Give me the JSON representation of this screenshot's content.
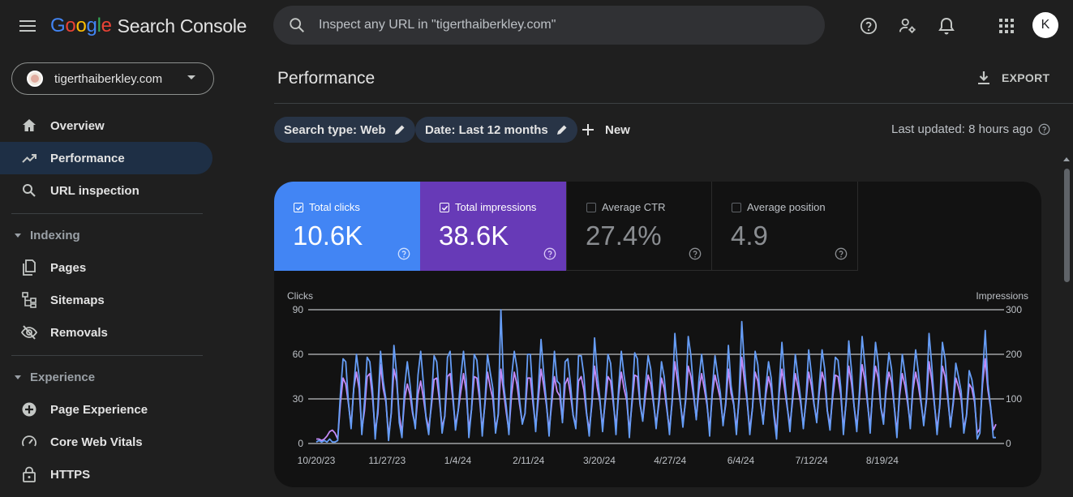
{
  "app": {
    "logo_letters": [
      "G",
      "o",
      "o",
      "g",
      "l",
      "e"
    ],
    "product": "Search Console"
  },
  "search": {
    "placeholder": "Inspect any URL in \"tigerthaiberkley.com\""
  },
  "user": {
    "avatar_initial": "K"
  },
  "icons": {
    "menu": "hamburger-menu-icon",
    "search": "search-icon",
    "help": "help-icon",
    "admin": "manage-users-icon",
    "notifications": "bell-icon",
    "apps": "apps-grid-icon",
    "export": "download-icon",
    "edit": "pencil-icon",
    "add": "plus-icon"
  },
  "property": {
    "name": "tigerthaiberkley.com"
  },
  "sidebar": {
    "top_items": [
      {
        "label": "Overview",
        "icon": "home-icon",
        "active": false
      },
      {
        "label": "Performance",
        "icon": "trending-up-icon",
        "active": true
      },
      {
        "label": "URL inspection",
        "icon": "search-icon",
        "active": false
      }
    ],
    "sections": [
      {
        "title": "Indexing",
        "items": [
          {
            "label": "Pages",
            "icon": "pages-icon"
          },
          {
            "label": "Sitemaps",
            "icon": "sitemap-icon"
          },
          {
            "label": "Removals",
            "icon": "visibility-off-icon"
          }
        ]
      },
      {
        "title": "Experience",
        "items": [
          {
            "label": "Page Experience",
            "icon": "plus-circle-icon"
          },
          {
            "label": "Core Web Vitals",
            "icon": "speed-icon"
          },
          {
            "label": "HTTPS",
            "icon": "lock-icon"
          }
        ]
      }
    ]
  },
  "main": {
    "title": "Performance",
    "export_label": "EXPORT",
    "filters": [
      {
        "label": "Search type: Web"
      },
      {
        "label": "Date: Last 12 months"
      }
    ],
    "new_label": "New",
    "last_updated": "Last updated: 8 hours ago"
  },
  "metrics": [
    {
      "label": "Total clicks",
      "value": "10.6K",
      "checked": true,
      "color": "#4285f4"
    },
    {
      "label": "Total impressions",
      "value": "38.6K",
      "checked": true,
      "color": "#673ab7"
    },
    {
      "label": "Average CTR",
      "value": "27.4%",
      "checked": false
    },
    {
      "label": "Average position",
      "value": "4.9",
      "checked": false
    }
  ],
  "chart_data": {
    "type": "line",
    "left_axis_label": "Clicks",
    "right_axis_label": "Impressions",
    "left_ticks": [
      0,
      30,
      60,
      90
    ],
    "right_ticks": [
      0,
      100,
      200,
      300
    ],
    "ylim_left": [
      0,
      90
    ],
    "ylim_right": [
      0,
      300
    ],
    "x_ticks": [
      "10/20/23",
      "11/27/23",
      "1/4/24",
      "2/11/24",
      "3/20/24",
      "4/27/24",
      "6/4/24",
      "7/12/24",
      "8/19/24"
    ],
    "x_start_date": "2023-10-20",
    "grid": true,
    "series": [
      {
        "name": "Clicks",
        "axis": "left",
        "color": "#669df6",
        "values": [
          1,
          2,
          1,
          2,
          1,
          3,
          1,
          1,
          2,
          33,
          57,
          55,
          28,
          10,
          38,
          60,
          45,
          6,
          28,
          58,
          55,
          37,
          3,
          24,
          62,
          42,
          30,
          2,
          21,
          66,
          47,
          14,
          4,
          38,
          55,
          40,
          22,
          10,
          46,
          62,
          41,
          17,
          6,
          28,
          59,
          55,
          33,
          7,
          19,
          58,
          62,
          34,
          9,
          22,
          45,
          62,
          43,
          4,
          23,
          60,
          56,
          35,
          5,
          28,
          60,
          48,
          37,
          7,
          20,
          90,
          40,
          25,
          6,
          45,
          62,
          51,
          29,
          13,
          20,
          60,
          60,
          31,
          8,
          37,
          70,
          47,
          28,
          5,
          32,
          62,
          42,
          40,
          14,
          55,
          57,
          40,
          19,
          10,
          59,
          59,
          46,
          21,
          5,
          29,
          71,
          47,
          30,
          8,
          31,
          60,
          54,
          30,
          6,
          38,
          62,
          46,
          34,
          4,
          30,
          61,
          57,
          27,
          15,
          39,
          59,
          50,
          29,
          10,
          29,
          55,
          45,
          25,
          6,
          30,
          74,
          51,
          29,
          11,
          30,
          72,
          59,
          35,
          16,
          43,
          60,
          44,
          28,
          5,
          37,
          59,
          46,
          34,
          12,
          28,
          66,
          39,
          27,
          6,
          32,
          82,
          52,
          30,
          6,
          24,
          62,
          53,
          28,
          13,
          38,
          55,
          44,
          19,
          3,
          39,
          68,
          44,
          25,
          8,
          33,
          60,
          45,
          30,
          10,
          30,
          63,
          47,
          27,
          14,
          40,
          63,
          50,
          22,
          9,
          35,
          58,
          56,
          38,
          6,
          28,
          69,
          50,
          25,
          8,
          35,
          72,
          53,
          29,
          7,
          38,
          68,
          54,
          24,
          13,
          41,
          61,
          50,
          25,
          4,
          36,
          60,
          47,
          30,
          10,
          42,
          63,
          48,
          29,
          12,
          30,
          74,
          53,
          27,
          6,
          26,
          68,
          57,
          33,
          11,
          28,
          54,
          45,
          35,
          7,
          19,
          49,
          43,
          31,
          3,
          7,
          45,
          76,
          40,
          25,
          4,
          4
        ]
      },
      {
        "name": "Impressions",
        "axis": "left",
        "color": "#c58af9",
        "values": [
          3,
          3,
          2,
          3,
          5,
          8,
          9,
          7,
          3,
          27,
          44,
          40,
          27,
          12,
          37,
          48,
          37,
          9,
          22,
          45,
          47,
          31,
          8,
          20,
          53,
          37,
          28,
          5,
          20,
          50,
          42,
          19,
          7,
          30,
          40,
          33,
          20,
          12,
          33,
          42,
          31,
          18,
          10,
          25,
          43,
          44,
          29,
          11,
          18,
          45,
          47,
          30,
          12,
          22,
          35,
          47,
          35,
          9,
          23,
          45,
          44,
          30,
          9,
          26,
          48,
          38,
          30,
          10,
          19,
          50,
          35,
          21,
          8,
          33,
          48,
          40,
          26,
          14,
          20,
          44,
          44,
          27,
          11,
          30,
          50,
          39,
          26,
          9,
          27,
          45,
          35,
          32,
          15,
          40,
          44,
          33,
          19,
          12,
          42,
          45,
          36,
          20,
          9,
          26,
          52,
          38,
          28,
          11,
          28,
          45,
          42,
          27,
          11,
          33,
          48,
          37,
          29,
          8,
          27,
          46,
          45,
          26,
          16,
          32,
          46,
          40,
          27,
          13,
          26,
          44,
          37,
          23,
          9,
          28,
          55,
          42,
          28,
          14,
          28,
          52,
          45,
          32,
          17,
          36,
          47,
          37,
          26,
          9,
          33,
          46,
          38,
          30,
          14,
          26,
          50,
          34,
          26,
          10,
          29,
          58,
          42,
          28,
          9,
          24,
          48,
          42,
          27,
          15,
          33,
          45,
          37,
          21,
          7,
          34,
          50,
          37,
          24,
          12,
          29,
          47,
          38,
          27,
          12,
          28,
          48,
          39,
          26,
          16,
          35,
          48,
          41,
          22,
          12,
          31,
          46,
          45,
          33,
          10,
          27,
          52,
          41,
          25,
          11,
          31,
          53,
          43,
          27,
          11,
          35,
          52,
          44,
          24,
          16,
          36,
          48,
          41,
          25,
          8,
          32,
          47,
          39,
          27,
          13,
          36,
          48,
          39,
          27,
          14,
          28,
          55,
          43,
          26,
          10,
          25,
          52,
          45,
          30,
          13,
          26,
          44,
          38,
          30,
          10,
          19,
          40,
          37,
          28,
          7,
          10,
          40,
          57,
          36,
          24,
          9,
          13
        ]
      }
    ]
  }
}
